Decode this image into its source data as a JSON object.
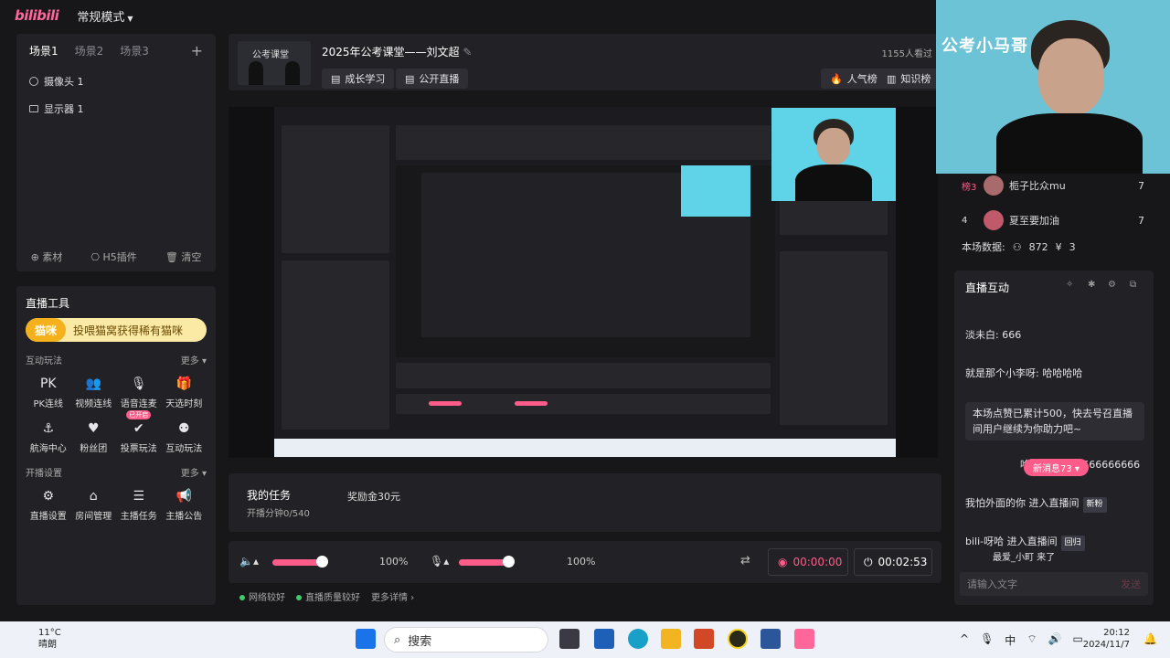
{
  "app": {
    "logo": "bilibili",
    "mode": "常规模式"
  },
  "scenes": {
    "tabs": [
      "场景1",
      "场景2",
      "场景3"
    ],
    "sources": [
      "摄像头 1",
      "显示器 1"
    ],
    "footer": [
      "素材",
      "H5插件",
      "清空"
    ]
  },
  "tools": {
    "title": "直播工具",
    "banner_tag": "猫咪",
    "banner_text": "投喂猫窝获得稀有猫咪",
    "interact_title": "互动玩法",
    "more": "更多",
    "interact_items": [
      {
        "label": "PK连线",
        "icon": "pk-icon"
      },
      {
        "label": "视频连线",
        "icon": "users-icon"
      },
      {
        "label": "语音连麦",
        "icon": "mic-icon",
        "badge": "已开启"
      },
      {
        "label": "天选时刻",
        "icon": "gift-icon"
      },
      {
        "label": "航海中心",
        "icon": "ship-icon"
      },
      {
        "label": "粉丝团",
        "icon": "fans-icon"
      },
      {
        "label": "投票玩法",
        "icon": "vote-icon"
      },
      {
        "label": "互动玩法",
        "icon": "interact-icon"
      }
    ],
    "broadcast_title": "开播设置",
    "broadcast_items": [
      {
        "label": "直播设置",
        "icon": "settings-icon"
      },
      {
        "label": "房间管理",
        "icon": "home-icon"
      },
      {
        "label": "主播任务",
        "icon": "task-icon"
      },
      {
        "label": "主播公告",
        "icon": "announce-icon"
      }
    ]
  },
  "header": {
    "thumb_text": "公考课堂",
    "title": "2025年公考课堂——刘文超",
    "btn_growth": "成长学习",
    "btn_public": "公开直播",
    "viewers": "1155人看过",
    "btn_popularity": "人气榜",
    "btn_knowledge": "知识榜"
  },
  "tasks": {
    "title": "我的任务",
    "progress": "开播分钟0/540",
    "reward": "奖励金30元"
  },
  "audio": {
    "speaker_level": 100,
    "speaker_pct": "100%",
    "mic_level": 100,
    "mic_pct": "100%",
    "rec_time": "00:00:00",
    "live_time": "00:02:53"
  },
  "status": {
    "network": "网络较好",
    "quality": "直播质量较好",
    "details": "更多详情"
  },
  "webcam": {
    "overlay": "公考小马哥"
  },
  "rank": {
    "rows": [
      {
        "rank": "榜3",
        "name": "栀子比众mu",
        "count": "7"
      },
      {
        "rank": "4",
        "name": "夏至要加油",
        "count": "7"
      }
    ],
    "summary_label": "本场数据:",
    "summary_viewers": "872",
    "summary_money": "3"
  },
  "chat": {
    "title": "直播互动",
    "messages": [
      {
        "text": "淡未白: 666"
      },
      {
        "text": "就是那个小李呀: 哈哈哈哈"
      },
      {
        "text": "本场点赞已累计500，快去号召直播间用户继续为你助力吧~"
      },
      {
        "text": "吟望枫: 6666666666666"
      },
      {
        "text": "我怕外面的你 进入直播间",
        "tag": "新粉"
      },
      {
        "text": "bili-呀哈 进入直播间",
        "tag": "回归"
      },
      {
        "text": "最爱_小町 来了"
      }
    ],
    "new_msg": "新消息73",
    "input_placeholder": "请输入文字",
    "send": "发送"
  },
  "taskbar": {
    "weather_temp": "11°C",
    "weather_desc": "晴朗",
    "search": "搜索",
    "ime": "中",
    "time": "20:12",
    "date": "2024/11/7"
  }
}
